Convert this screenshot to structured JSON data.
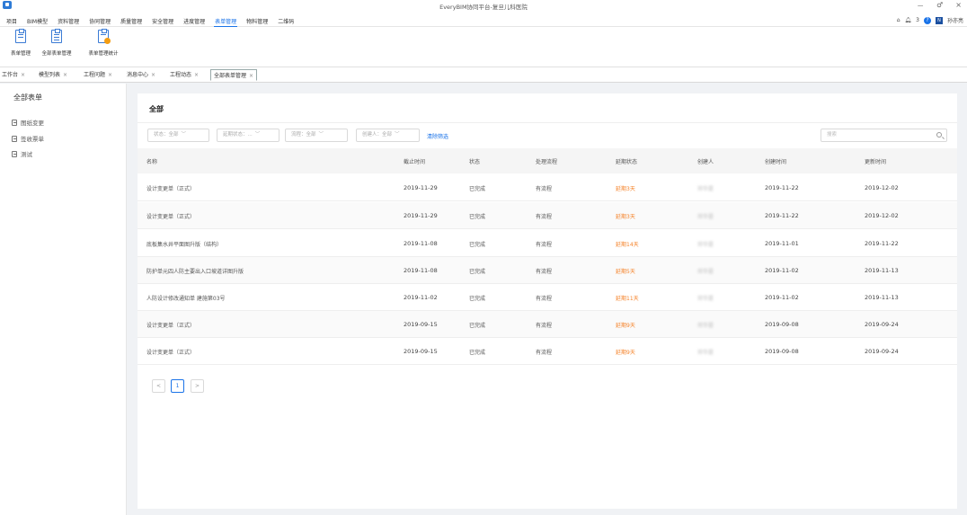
{
  "window": {
    "title": "EveryBIM协同平台-复旦儿科医院",
    "controls": [
      "－",
      "♂",
      "×"
    ]
  },
  "menu": {
    "items": [
      "项目",
      "BIM模型",
      "资料管理",
      "协同管理",
      "质量管理",
      "安全管理",
      "进度管理",
      "表单管理",
      "物料管理",
      "二维码"
    ],
    "active_index": 7,
    "notification_count": "3",
    "help": "?",
    "avatar_text": "N",
    "user_name": "孙亦亮"
  },
  "ribbon": {
    "buttons": [
      {
        "label": "表单管理",
        "icon": "form-edit-icon"
      },
      {
        "label": "全部表单管理",
        "icon": "form-list-icon"
      },
      {
        "label": "表单管理统计",
        "icon": "form-stats-icon"
      }
    ]
  },
  "doc_tabs": {
    "items": [
      "工作台",
      "模型列表",
      "工程问题",
      "消息中心",
      "工程动态",
      "全部表单管理"
    ],
    "close": "×",
    "active_index": 5
  },
  "left_panel": {
    "title": "全部表单",
    "items": [
      "图纸变更",
      "签收票单",
      "测试"
    ]
  },
  "main": {
    "title": "全部",
    "filters": {
      "status": "状态：全部",
      "delay_status": "延期状态：...",
      "flow": "流程：全部",
      "creator": "创建人：全部",
      "clear": "清除筛选"
    },
    "search_placeholder": "搜索",
    "columns": [
      "名称",
      "截止时间",
      "状态",
      "处理流程",
      "延期状态",
      "创建人",
      "创建时间",
      "更新时间"
    ],
    "rows": [
      {
        "name": "设计变更单（正式）",
        "deadline": "2019-11-29",
        "status": "已完成",
        "flow": "有流程",
        "delay": "延期3天",
        "creator": "邓华是",
        "created": "2019-11-22",
        "updated": "2019-12-02"
      },
      {
        "name": "设计变更单（正式）",
        "deadline": "2019-11-29",
        "status": "已完成",
        "flow": "有流程",
        "delay": "延期3天",
        "creator": "邓华是",
        "created": "2019-11-22",
        "updated": "2019-12-02"
      },
      {
        "name": "底板集水井平面图升版（结构）",
        "deadline": "2019-11-08",
        "status": "已完成",
        "flow": "有流程",
        "delay": "延期14天",
        "creator": "邓华是",
        "created": "2019-11-01",
        "updated": "2019-11-22"
      },
      {
        "name": "防护单元四人防主要出入口坡道详图升版",
        "deadline": "2019-11-08",
        "status": "已完成",
        "flow": "有流程",
        "delay": "延期5天",
        "creator": "邓华是",
        "created": "2019-11-02",
        "updated": "2019-11-13"
      },
      {
        "name": "人防设计修改通知单 建施第03号",
        "deadline": "2019-11-02",
        "status": "已完成",
        "flow": "有流程",
        "delay": "延期11天",
        "creator": "邓华是",
        "created": "2019-11-02",
        "updated": "2019-11-13"
      },
      {
        "name": "设计变更单（正式）",
        "deadline": "2019-09-15",
        "status": "已完成",
        "flow": "有流程",
        "delay": "延期9天",
        "creator": "邓华是",
        "created": "2019-09-08",
        "updated": "2019-09-24"
      },
      {
        "name": "设计变更单（正式）",
        "deadline": "2019-09-15",
        "status": "已完成",
        "flow": "有流程",
        "delay": "延期9天",
        "creator": "邓华是",
        "created": "2019-09-08",
        "updated": "2019-09-24"
      }
    ],
    "pagination": {
      "prev": "<",
      "current": "1",
      "next": ">"
    }
  },
  "colors": {
    "accent": "#1a73e8",
    "delay": "#f5832a",
    "ribbon_icon": "#3a7bd5",
    "badge": "#f39c12"
  }
}
